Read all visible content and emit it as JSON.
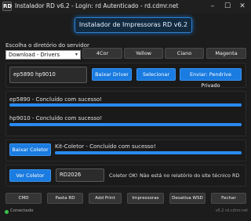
{
  "window": {
    "icon_text": "RD",
    "title": "Instalador RD v6.2 - Login: rd Autenticado - rd.cdmr.net",
    "minimize": "–",
    "maximize": "☐",
    "close": "✕"
  },
  "header": {
    "title": "Instalador de Impressoras RD v6.2"
  },
  "server": {
    "label": "Escolha o diretório do servidor",
    "selected": "Download - Drivers",
    "arrow": "▾"
  },
  "brand_buttons": [
    "4Cor",
    "Yellow",
    "Ciano",
    "Magenta"
  ],
  "search": {
    "value": "ep5890 hp9010",
    "baixar_label": "Baixar Driver",
    "selecionar_label": "Selecionar",
    "enviar_label": "Enviar: Pendrive Privado"
  },
  "downloads": [
    {
      "message": "ep5890 - Concluído com sucesso!",
      "progress": 1.0
    },
    {
      "message": "hp9010 - Concluído com sucesso!",
      "progress": 1.0
    }
  ],
  "coletor": {
    "button_label": "Baixar Coletor",
    "message": "Kit-Coletor - Concluído com sucesso!",
    "progress": 1.0
  },
  "ver_coletor": {
    "button_label": "Ver Coletor",
    "code": "RD2026",
    "message": "Coletor OK! Não está no relatório do site técnico RD"
  },
  "footer_buttons": [
    "CMD",
    "Pasta RD",
    "Add Print",
    "Impressoras",
    "Desativa WSD",
    "Fechar"
  ],
  "status": {
    "text": "Conectado",
    "version": "v6.2 rd.cdmr.net",
    "dot_color": "#3cc44a"
  },
  "colors": {
    "accent": "#1a7be0",
    "background": "#1c1c1c"
  }
}
